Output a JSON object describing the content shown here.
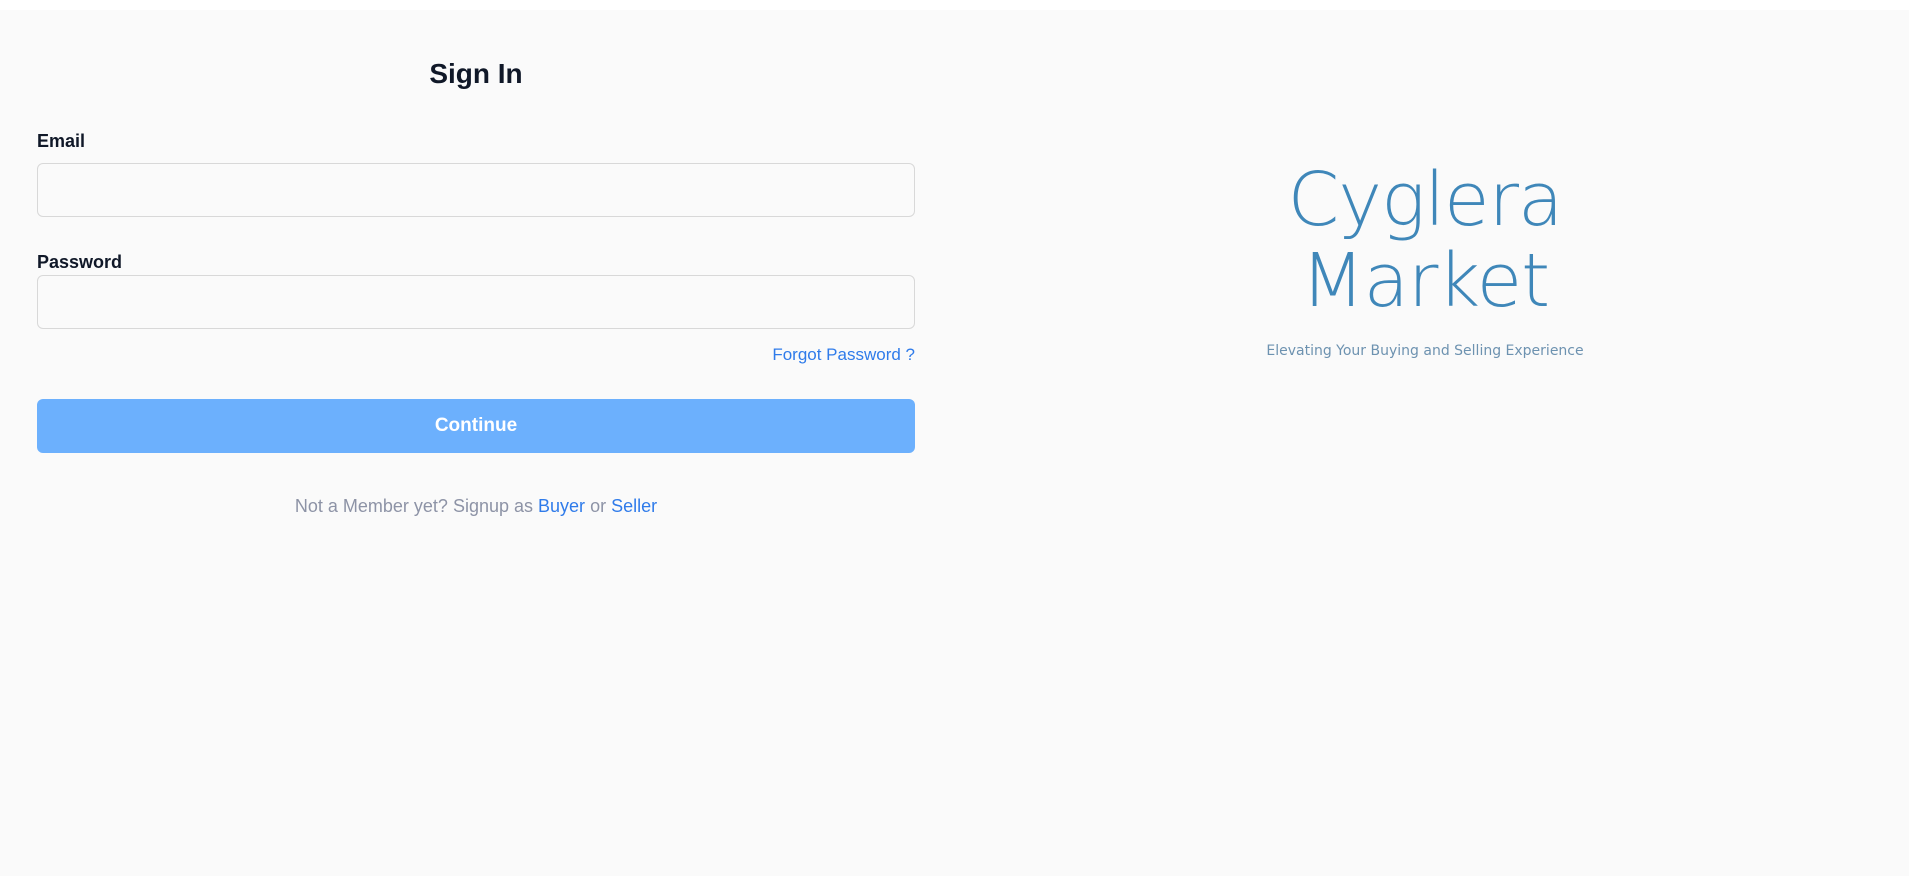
{
  "signin": {
    "title": "Sign In",
    "email_label": "Email",
    "email_value": "",
    "password_label": "Password",
    "password_value": "",
    "forgot_label": "Forgot Password ?",
    "continue_label": "Continue",
    "signup_prefix": "Not a Member yet? Signup as",
    "buyer_link": "Buyer",
    "or_text": "or",
    "seller_link": "Seller"
  },
  "brand": {
    "name": "Cyglera Market",
    "tagline": "Elevating Your Buying and Selling Experience"
  },
  "colors": {
    "accent": "#2f7bea",
    "button": "#6cb0fd",
    "brand": "#3f87b9",
    "heading": "#101828"
  }
}
